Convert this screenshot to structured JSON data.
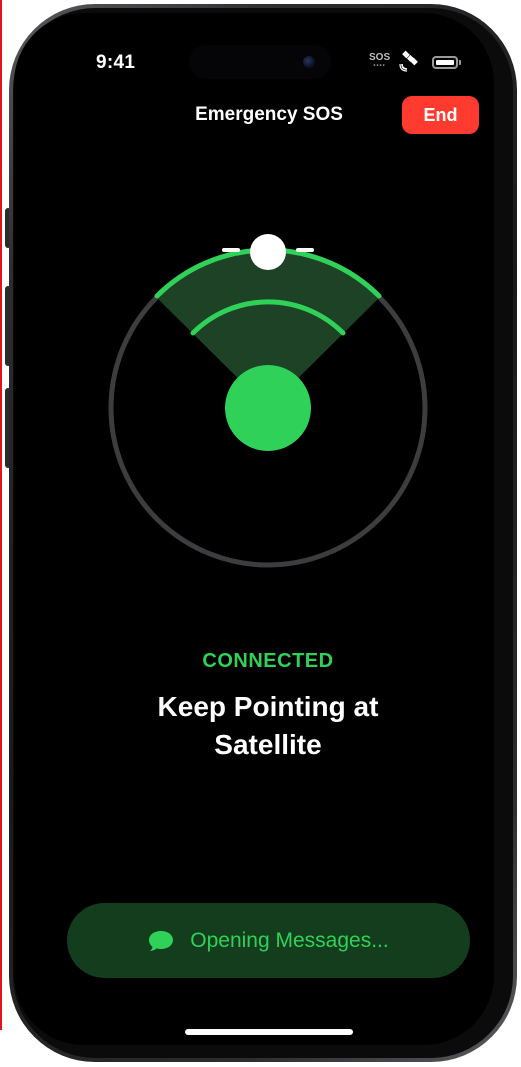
{
  "status_bar": {
    "time": "9:41",
    "carrier_label": "SOS",
    "satellite_icon": "satellite-icon",
    "battery_icon": "battery-full-icon"
  },
  "nav": {
    "title": "Emergency SOS",
    "end_label": "End"
  },
  "satellite_indicator": {
    "status": "CONNECTED",
    "headline": "Keep Pointing at Satellite"
  },
  "message_button": {
    "label": "Opening Messages...",
    "icon": "speech-bubble-icon"
  },
  "colors": {
    "accent_green": "#2fd158",
    "end_red": "#ff3b30",
    "pill_green": "#143d1d",
    "background": "#000000"
  }
}
